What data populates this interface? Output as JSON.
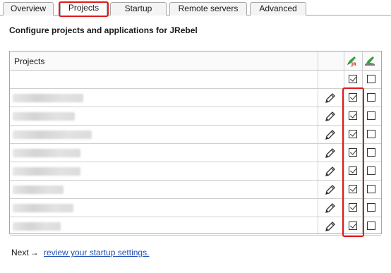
{
  "tabs": [
    {
      "label": "Overview"
    },
    {
      "label": "Projects",
      "active": true
    },
    {
      "label": "Startup"
    },
    {
      "label": "Remote servers"
    },
    {
      "label": "Advanced"
    }
  ],
  "heading": "Configure projects and applications for JRebel",
  "table": {
    "column_title": "Projects",
    "header_icons": [
      "jrebel-rocket-icon",
      "remote-rocket-icon"
    ],
    "select_all_row": {
      "jrebel_checked": true,
      "remote_checked": false
    },
    "rows": [
      {
        "jrebel_checked": true,
        "remote_checked": false
      },
      {
        "jrebel_checked": true,
        "remote_checked": false
      },
      {
        "jrebel_checked": true,
        "remote_checked": false
      },
      {
        "jrebel_checked": true,
        "remote_checked": false
      },
      {
        "jrebel_checked": true,
        "remote_checked": false
      },
      {
        "jrebel_checked": true,
        "remote_checked": false
      },
      {
        "jrebel_checked": true,
        "remote_checked": false
      },
      {
        "jrebel_checked": true,
        "remote_checked": false
      }
    ]
  },
  "footer": {
    "next_label": "Next",
    "link_text": "review your startup settings."
  },
  "colors": {
    "highlight": "#e01b1b",
    "link": "#1f4fb3",
    "rocket_green": "#3aa142"
  }
}
